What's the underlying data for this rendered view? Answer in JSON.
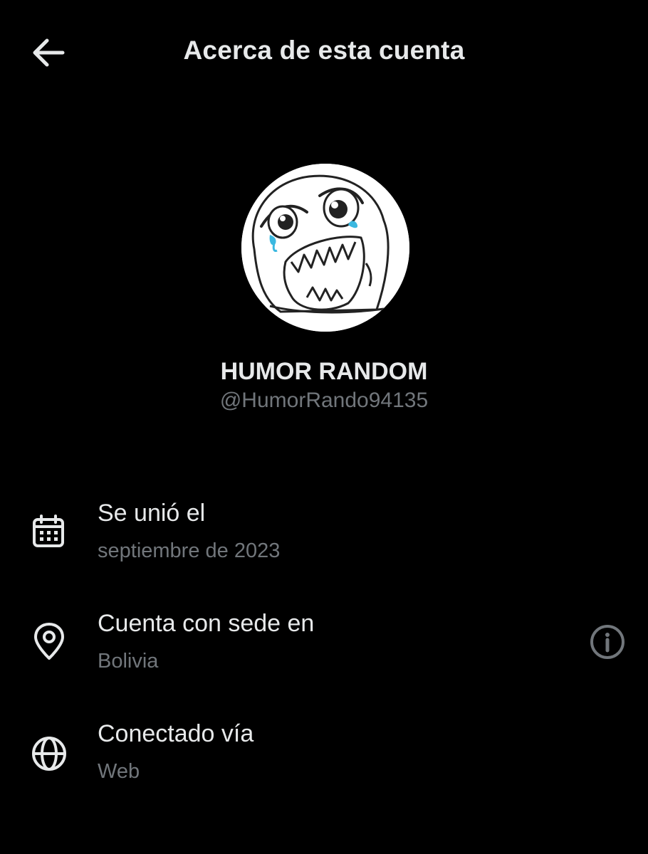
{
  "header": {
    "title": "Acerca de esta cuenta",
    "back_icon": "arrow-left-icon"
  },
  "profile": {
    "avatar_icon": "rage-face-avatar",
    "name": "HUMOR RANDOM",
    "handle": "@HumorRando94135"
  },
  "details": {
    "joined": {
      "icon": "calendar-icon",
      "label": "Se unió el",
      "value": "septiembre de 2023"
    },
    "location": {
      "icon": "location-pin-icon",
      "label": "Cuenta con sede en",
      "value": "Bolivia",
      "info_icon": "info-icon"
    },
    "connected": {
      "icon": "globe-icon",
      "label": "Conectado vía",
      "value": "Web"
    }
  },
  "colors": {
    "background": "#000000",
    "primary_text": "#e7e9ea",
    "secondary_text": "#71767b",
    "tear_blue": "#3bb8e0"
  }
}
